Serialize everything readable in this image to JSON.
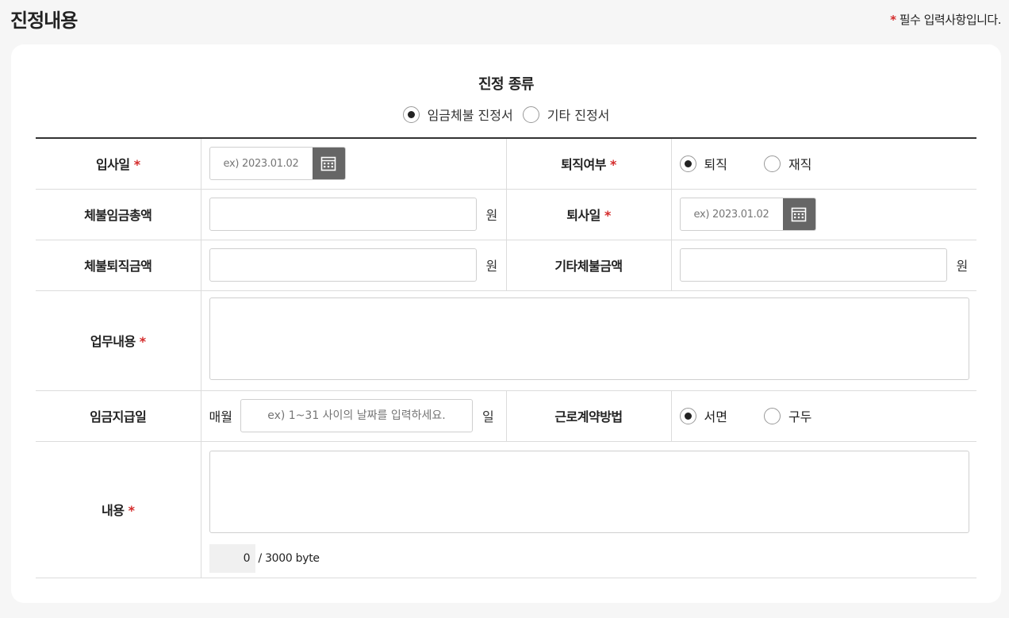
{
  "header": {
    "title": "진정내용",
    "required_star": "*",
    "required_note": "필수 입력사항입니다."
  },
  "petition_type": {
    "title": "진정 종류",
    "options": [
      {
        "label": "임금체불 진정서",
        "selected": true
      },
      {
        "label": "기타 진정서",
        "selected": false
      }
    ]
  },
  "form": {
    "star": "*",
    "hire_date": {
      "label": "입사일",
      "placeholder": "ex) 2023.01.02"
    },
    "retirement_status": {
      "label": "퇴직여부",
      "options": [
        {
          "label": "퇴직",
          "selected": true
        },
        {
          "label": "재직",
          "selected": false
        }
      ]
    },
    "unpaid_wage_total": {
      "label": "체불임금총액",
      "value": "",
      "unit": "원"
    },
    "leave_date": {
      "label": "퇴사일",
      "placeholder": "ex) 2023.01.02"
    },
    "unpaid_severance": {
      "label": "체불퇴직금액",
      "value": "",
      "unit": "원"
    },
    "other_unpaid": {
      "label": "기타체불금액",
      "value": "",
      "unit": "원"
    },
    "job_description": {
      "label": "업무내용",
      "value": ""
    },
    "pay_day": {
      "label": "임금지급일",
      "prefix": "매월",
      "placeholder": "ex) 1~31 사이의 날짜를 입력하세요.",
      "unit": "일"
    },
    "contract_method": {
      "label": "근로계약방법",
      "options": [
        {
          "label": "서면",
          "selected": true
        },
        {
          "label": "구두",
          "selected": false
        }
      ]
    },
    "content": {
      "label": "내용",
      "value": "",
      "byte_count": "0",
      "byte_limit": "/ 3000 byte"
    }
  },
  "icons": {
    "calendar": "calendar-icon"
  },
  "colors": {
    "required": "#d42a2a",
    "calendar_button": "#666666",
    "background": "#f6f6f6"
  }
}
